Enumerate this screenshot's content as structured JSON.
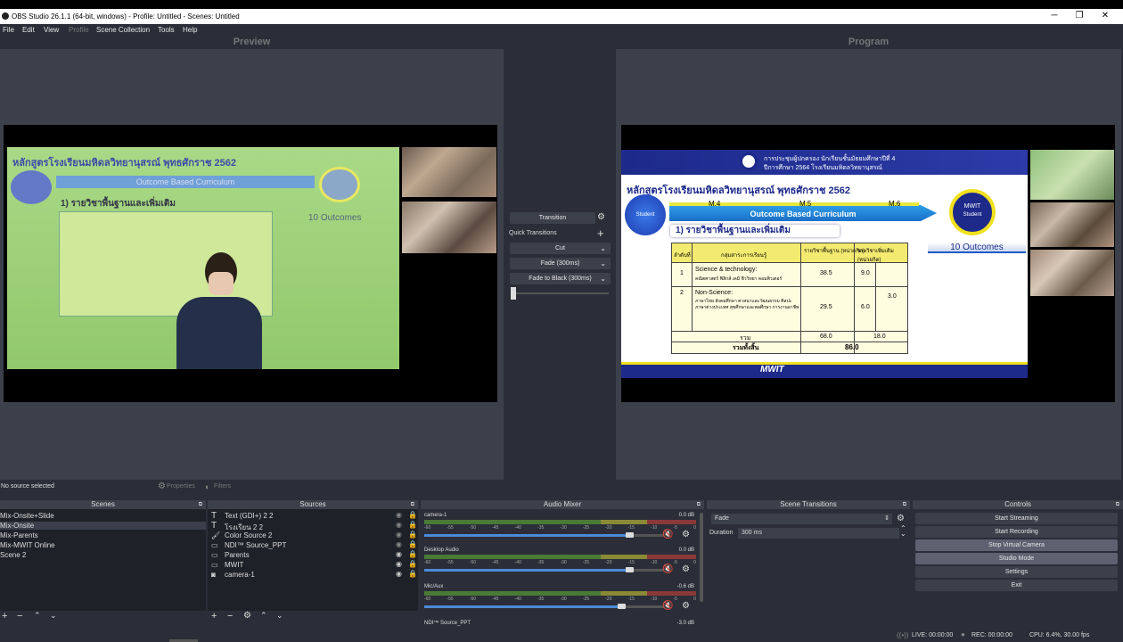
{
  "window": {
    "title": "OBS Studio 26.1.1 (64-bit, windows) - Profile: Untitled - Scenes: Untitled"
  },
  "menu": [
    "File",
    "Edit",
    "View",
    "Profile",
    "Scene Collection",
    "Tools",
    "Help"
  ],
  "preview": {
    "label": "Preview",
    "slide_title": "หลักสูตรโรงเรียนมหิดลวิทยานุสรณ์ พุทธศักราช 2562",
    "arrow_text": "Outcome Based Curriculum",
    "subtitle": "1) รายวิชาพื้นฐานและเพิ่มเติม",
    "outcomes": "10 Outcomes"
  },
  "program": {
    "label": "Program",
    "header_line1": "การประชุมผู้ปกครอง นักเรียนชั้นมัธยมศึกษาปีที่ 4",
    "header_line2": "ปีการศึกษา 2564 โรงเรียนมหิดลวิทยานุสรณ์",
    "slide_title": "หลักสูตรโรงเรียนมหิดลวิทยานุสรณ์ พุทธศักราช 2562",
    "student": "Student",
    "m4": "M.4",
    "m5": "M.5",
    "m6": "M.6",
    "arrow_text": "Outcome Based Curriculum",
    "mwit_line1": "MWIT",
    "mwit_line2": "Student",
    "subtitle": "1) รายวิชาพื้นฐานและเพิ่มเติม",
    "outcomes": "10 Outcomes",
    "table": {
      "h_no": "ลำดับที่",
      "h_group": "กลุ่มสาระการเรียนรู้",
      "h_basic": "รายวิชาพื้นฐาน (หน่วยกิต)",
      "h_extra": "รายวิชาเพิ่มเติม (หน่วยกิต)",
      "r1_no": "1",
      "r1_name": "Science & technology:",
      "r1_sub": "คณิตศาสตร์ ฟิสิกส์ เคมี ชีววิทยา คอมพิวเตอร์",
      "r1_basic": "38.5",
      "r1_extra": "9.0",
      "r2_no": "2",
      "r2_name": "Non-Science:",
      "r2_sub": "ภาษาไทย สังคมศึกษา ศาสนาและวัฒนธรรม ศิลปะ ภาษาต่างประเทศ สุขศึกษาและพลศึกษา การงานอาชีพ",
      "r2_basic": "29.5",
      "r2_extra": "6.0",
      "merged": "3.0",
      "sum_label": "รวม",
      "sum_basic": "68.0",
      "sum_extra": "18.0",
      "total_label": "รวมทั้งสิ้น",
      "total": "86.0"
    },
    "footer_logo": "MWIT"
  },
  "transitions_col": {
    "transition": "Transition",
    "quick": "Quick Transitions",
    "cut": "Cut",
    "fade": "Fade (300ms)",
    "fade_black": "Fade to Black (300ms)"
  },
  "status": {
    "no_source": "No source selected",
    "properties": "Properties",
    "filters": "Filters"
  },
  "scenes": {
    "header": "Scenes",
    "items": [
      "Mix-Onsite+Slide",
      "Mix-Onsite",
      "Mix-Parents",
      "Mix-MWIT Online",
      "Scene 2"
    ]
  },
  "sources": {
    "header": "Sources",
    "items": [
      "Text (GDI+) 2 2",
      "โรงเรียน 2 2",
      "Color Source 2",
      "NDI™ Source_PPT",
      "Parents",
      "MWIT",
      "camera-1"
    ]
  },
  "mixer": {
    "header": "Audio Mixer",
    "tracks": [
      {
        "name": "camera-1",
        "db": "0.0 dB",
        "level": 0.85
      },
      {
        "name": "Desktop Audio",
        "db": "0.0 dB",
        "level": 0.85
      },
      {
        "name": "Mic/Aux",
        "db": "-0.6 dB",
        "level": 0.82
      },
      {
        "name": "NDI™ Source_PPT",
        "db": "-3.0 dB",
        "level": 0.8
      }
    ],
    "scale": [
      "-60",
      "-55",
      "-50",
      "-45",
      "-40",
      "-35",
      "-30",
      "-25",
      "-20",
      "-15",
      "-10",
      "-5",
      "0"
    ]
  },
  "scene_transitions": {
    "header": "Scene Transitions",
    "type": "Fade",
    "duration_label": "Duration",
    "duration": "300 ms"
  },
  "controls": {
    "header": "Controls",
    "buttons": [
      "Start Streaming",
      "Start Recording",
      "Stop Virtual Camera",
      "Studio Mode",
      "Settings",
      "Exit"
    ]
  },
  "footer": {
    "live": "LIVE: 00:00:00",
    "rec": "REC: 00:00:00",
    "cpu": "CPU: 6.4%, 30.00 fps"
  }
}
